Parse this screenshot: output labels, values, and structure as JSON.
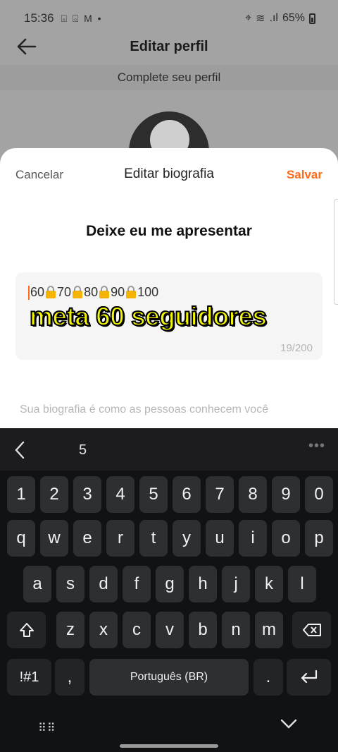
{
  "status_bar": {
    "time": "15:36",
    "left_icons": "⌻ ⌻ M •",
    "battery": "65%"
  },
  "background": {
    "title": "Editar perfil",
    "subtitle": "Complete seu perfil"
  },
  "sheet": {
    "cancel": "Cancelar",
    "title": "Editar biografia",
    "save": "Salvar",
    "section_title": "Deixe eu me apresentar",
    "bio": {
      "nums": [
        "60",
        "70",
        "80",
        "90",
        "100"
      ],
      "counter": "19/200"
    },
    "hint": "Sua biografia é como as pessoas conhecem você"
  },
  "overlay_caption": "meta 60 seguidores",
  "keyboard": {
    "suggestion": "5",
    "numbers": [
      "1",
      "2",
      "3",
      "4",
      "5",
      "6",
      "7",
      "8",
      "9",
      "0"
    ],
    "row1": [
      "q",
      "w",
      "e",
      "r",
      "t",
      "y",
      "u",
      "i",
      "o",
      "p"
    ],
    "row2": [
      "a",
      "s",
      "d",
      "f",
      "g",
      "h",
      "j",
      "k",
      "l"
    ],
    "row3": [
      "z",
      "x",
      "c",
      "v",
      "b",
      "n",
      "m"
    ],
    "symbols": "!#1",
    "comma": ",",
    "space": "Português (BR)",
    "period": "."
  },
  "colors": {
    "accent": "#ff6a1a",
    "caption": "#f2f600"
  }
}
